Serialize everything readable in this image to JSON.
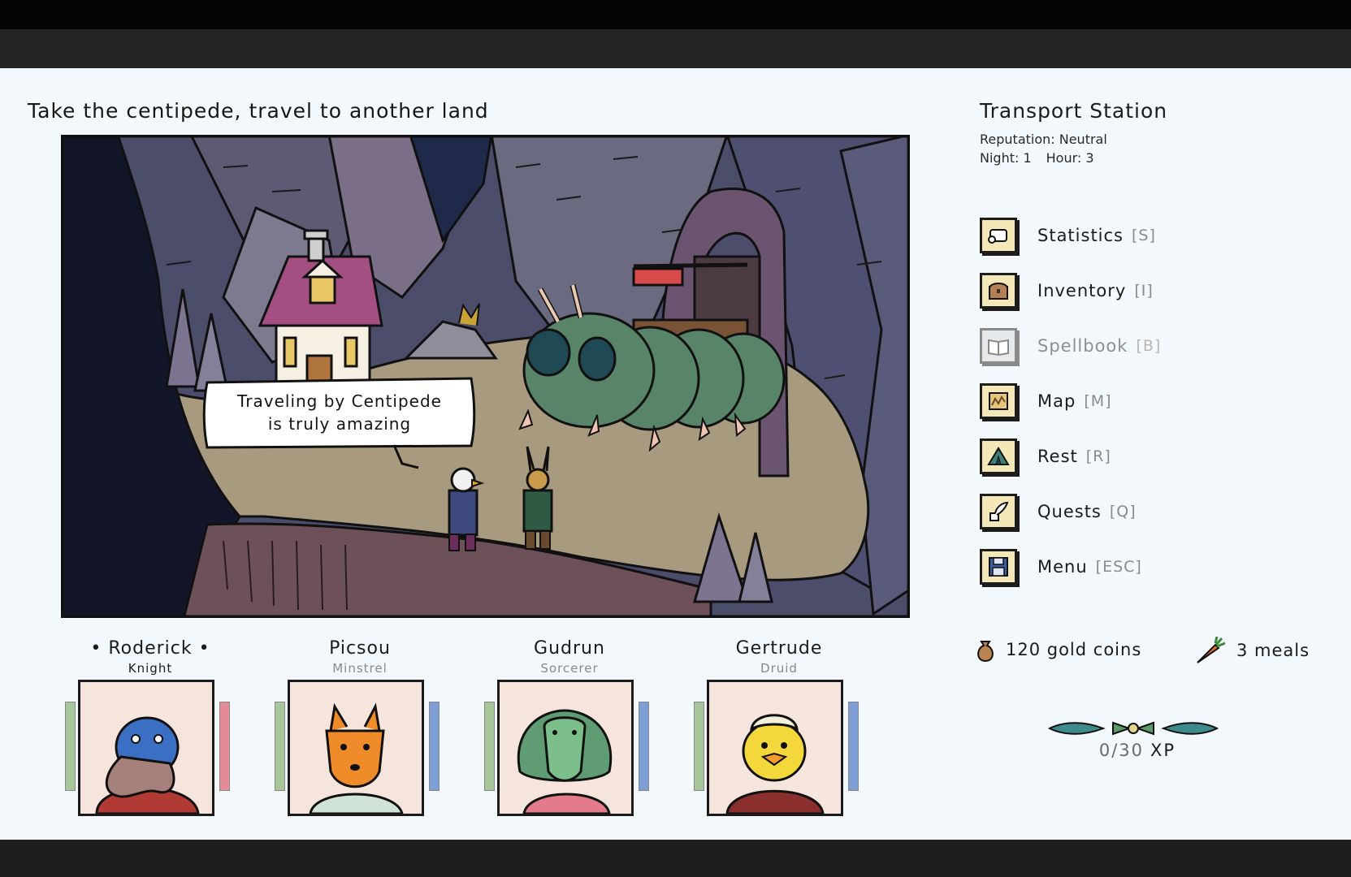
{
  "quest": {
    "title": "Take the centipede, travel to another land"
  },
  "scene": {
    "speech_line1": "Traveling by Centipede",
    "speech_line2": "is truly amazing"
  },
  "location": {
    "title": "Transport Station",
    "reputation": "Reputation: Neutral",
    "night": "Night: 1",
    "hour": "Hour: 3"
  },
  "menu": [
    {
      "label": "Statistics",
      "key": "[S]",
      "icon": "scroll-icon",
      "enabled": true
    },
    {
      "label": "Inventory",
      "key": "[I]",
      "icon": "chest-icon",
      "enabled": true
    },
    {
      "label": "Spellbook",
      "key": "[B]",
      "icon": "book-icon",
      "enabled": false
    },
    {
      "label": "Map",
      "key": "[M]",
      "icon": "map-icon",
      "enabled": true
    },
    {
      "label": "Rest",
      "key": "[R]",
      "icon": "tent-icon",
      "enabled": true
    },
    {
      "label": "Quests",
      "key": "[Q]",
      "icon": "quill-icon",
      "enabled": true
    },
    {
      "label": "Menu",
      "key": "[ESC]",
      "icon": "floppy-disk-icon",
      "enabled": true
    }
  ],
  "party": [
    {
      "name": "• Roderick •",
      "class": "Knight",
      "portrait": "platypus-portrait",
      "leader": true,
      "mp_color": "#e48b97"
    },
    {
      "name": "Picsou",
      "class": "Minstrel",
      "portrait": "fox-portrait",
      "leader": false,
      "mp_color": "#7d9fd6"
    },
    {
      "name": "Gudrun",
      "class": "Sorcerer",
      "portrait": "cobra-portrait",
      "leader": false,
      "mp_color": "#7d9fd6"
    },
    {
      "name": "Gertrude",
      "class": "Druid",
      "portrait": "chick-portrait",
      "leader": false,
      "mp_color": "#7d9fd6"
    }
  ],
  "resources": {
    "gold": "120 gold coins",
    "meals": "3 meals"
  },
  "xp": {
    "value": "0/30",
    "unit": "XP"
  }
}
